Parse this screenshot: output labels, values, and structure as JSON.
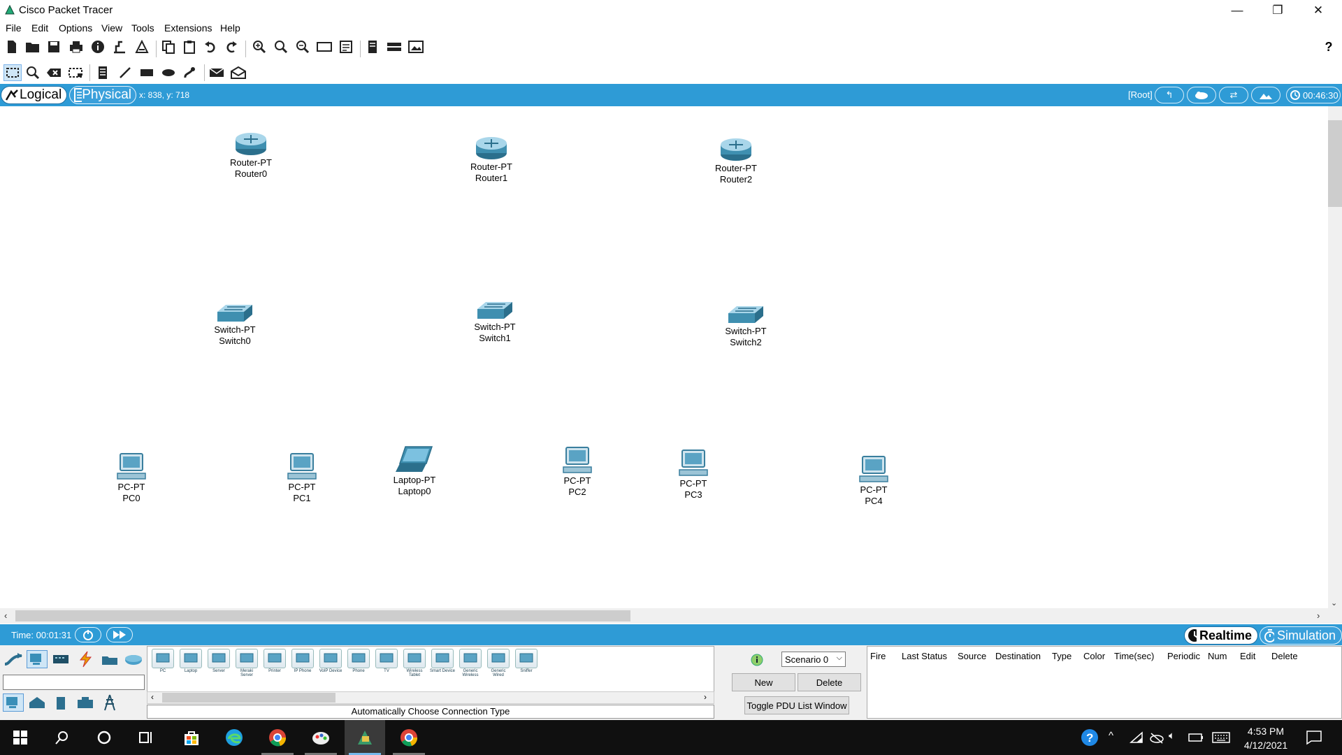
{
  "window": {
    "title": "Cisco Packet Tracer",
    "minimize": "—",
    "restore": "❐",
    "close": "✕"
  },
  "menu": [
    "File",
    "Edit",
    "Options",
    "View",
    "Tools",
    "Extensions",
    "Help"
  ],
  "help_glyph": "?",
  "workspace": {
    "logical_label": "Logical",
    "physical_label": "Physical",
    "coords": "x: 838, y: 718",
    "root_label": "[Root]",
    "clock": "00:46:30"
  },
  "devices": [
    {
      "model": "Router-PT",
      "name": "Router0",
      "kind": "router"
    },
    {
      "model": "Router-PT",
      "name": "Router1",
      "kind": "router"
    },
    {
      "model": "Router-PT",
      "name": "Router2",
      "kind": "router"
    },
    {
      "model": "Switch-PT",
      "name": "Switch0",
      "kind": "switch"
    },
    {
      "model": "Switch-PT",
      "name": "Switch1",
      "kind": "switch"
    },
    {
      "model": "Switch-PT",
      "name": "Switch2",
      "kind": "switch"
    },
    {
      "model": "PC-PT",
      "name": "PC0",
      "kind": "pc"
    },
    {
      "model": "PC-PT",
      "name": "PC1",
      "kind": "pc"
    },
    {
      "model": "Laptop-PT",
      "name": "Laptop0",
      "kind": "laptop"
    },
    {
      "model": "PC-PT",
      "name": "PC2",
      "kind": "pc"
    },
    {
      "model": "PC-PT",
      "name": "PC3",
      "kind": "pc"
    },
    {
      "model": "PC-PT",
      "name": "PC4",
      "kind": "pc"
    }
  ],
  "status_bar": {
    "time": "Time: 00:01:31",
    "realtime_label": "Realtime",
    "simulation_label": "Simulation"
  },
  "device_types": [
    "PC",
    "Laptop",
    "Server",
    "Meraki Server",
    "Printer",
    "IP Phone",
    "VoIP Device",
    "Phone",
    "TV",
    "Wireless Tablet",
    "Smart Device",
    "Generic Wireless",
    "Generic Wired",
    "Sniffer"
  ],
  "connection_label": "Automatically Choose Connection Type",
  "scenario": {
    "selected": "Scenario 0",
    "new_label": "New",
    "delete_label": "Delete",
    "toggle_label": "Toggle PDU List Window"
  },
  "pdu_columns": [
    "Fire",
    "Last Status",
    "Source",
    "Destination",
    "Type",
    "Color",
    "Time(sec)",
    "Periodic",
    "Num",
    "Edit",
    "Delete"
  ],
  "taskbar": {
    "time": "4:53 PM",
    "date": "4/12/2021"
  }
}
